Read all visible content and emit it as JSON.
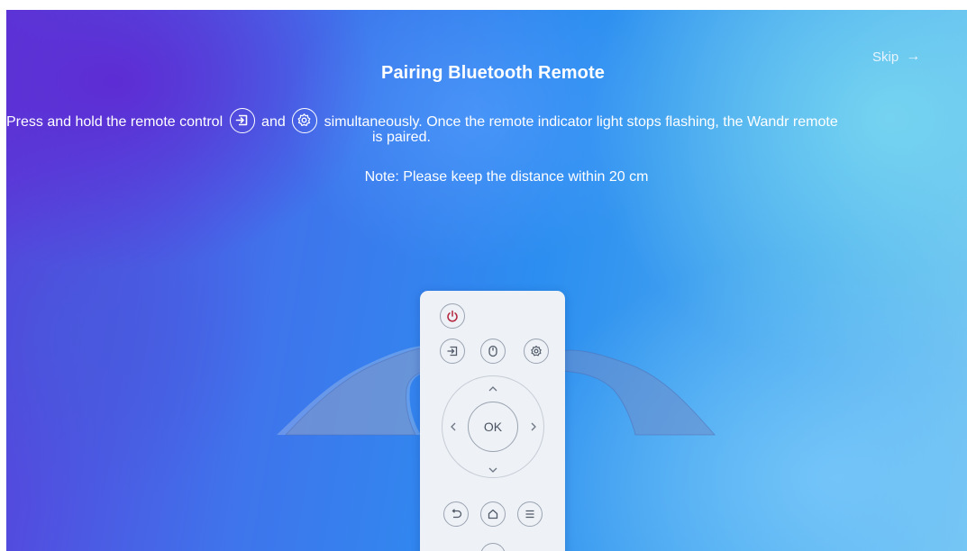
{
  "header": {
    "title": "Pairing Bluetooth Remote",
    "skip_label": "Skip",
    "skip_arrow": "→"
  },
  "instructions": {
    "part1": "Press and hold the remote control",
    "icon1": "input-source-icon",
    "part2": "and",
    "icon2": "settings-gear-icon",
    "part3": "simultaneously. Once the remote indicator light stops flashing, the Wandr remote",
    "part4": "is paired.",
    "note": "Note: Please keep the distance within 20 cm"
  },
  "remote": {
    "ok_label": "OK",
    "buttons": [
      "power-icon",
      "input-source-icon",
      "mouse-icon",
      "settings-gear-icon",
      "up-icon",
      "left-icon",
      "right-icon",
      "down-icon",
      "back-icon",
      "home-icon",
      "menu-icon",
      "plus-icon"
    ]
  },
  "colors": {
    "power_button": "#b4233c",
    "text": "#ffffff"
  }
}
